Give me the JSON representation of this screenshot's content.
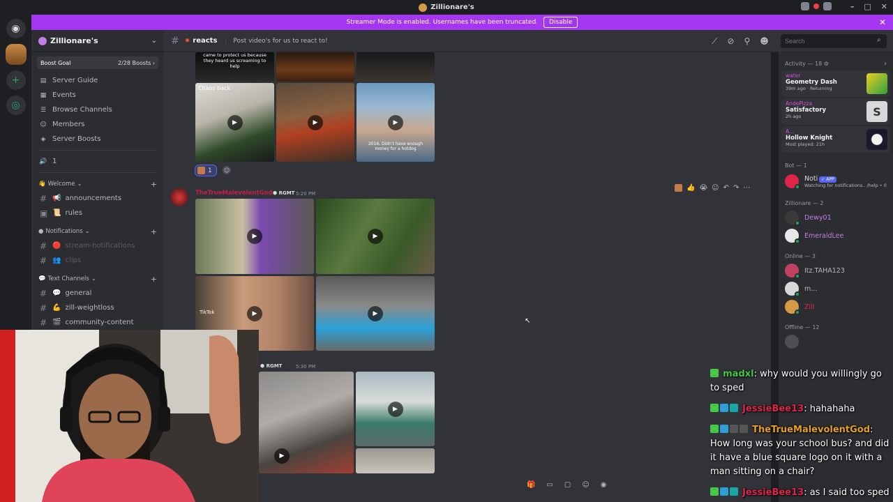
{
  "window": {
    "title": "Zillionare's"
  },
  "banner": {
    "message": "Streamer Mode is enabled. Usernames have been truncated.",
    "disable_label": "Disable",
    "color": "#a435f0"
  },
  "server": {
    "name": "Zillionare's",
    "boost_goal": "Boost Goal",
    "boost_count": "2/28 Boosts",
    "nav": [
      {
        "label": "Server Guide",
        "icon": "guide-icon"
      },
      {
        "label": "Events",
        "icon": "calendar-icon"
      },
      {
        "label": "Browse Channels",
        "icon": "browse-icon"
      },
      {
        "label": "Members",
        "icon": "members-icon"
      },
      {
        "label": "Server Boosts",
        "icon": "boost-icon"
      }
    ],
    "voice_count": "1",
    "categories": [
      {
        "name": "Welcome",
        "channels": [
          {
            "name": "announcements",
            "emoji": "📢"
          },
          {
            "name": "rules",
            "emoji": "📜"
          }
        ]
      },
      {
        "name": "Notifications",
        "channels": [
          {
            "name": "stream-notifications",
            "emoji": "🔴"
          },
          {
            "name": "clips",
            "emoji": "👥"
          }
        ]
      },
      {
        "name": "Text Channels",
        "channels": [
          {
            "name": "general",
            "emoji": "💬"
          },
          {
            "name": "zill-weightloss",
            "emoji": "💪"
          },
          {
            "name": "community-content",
            "emoji": "🎬"
          }
        ]
      }
    ]
  },
  "channel": {
    "name": "reacts",
    "topic": "Post video's for us to react to!",
    "search_placeholder": "Search"
  },
  "messages": {
    "reaction_count": "1",
    "author": "TheTrueMalevolentGod",
    "tag": "RGMT",
    "time1": "5:20 PM",
    "time2": "5:30 PM",
    "thumb_texts": {
      "t1": "came to protect us because they heard us screaming to help",
      "t2": "Chaos back",
      "t3": "2016, Didn't have enough money for a hotdog",
      "tiktok": "TikTok"
    }
  },
  "members": {
    "activity_header": "Activity — 18",
    "activities": [
      {
        "user": "water",
        "game": "Geometry Dash",
        "sub": "39m ago · Returning"
      },
      {
        "user": "AndePizza",
        "game": "Satisfactory",
        "sub": "2h ago"
      },
      {
        "user": "A...",
        "game": "Hollow Knight",
        "sub": "Most played: 21h"
      }
    ],
    "bot_header": "Bot — 1",
    "bot": {
      "name": "Noti",
      "badge": "APP",
      "sub": "Watching for notifications.. /help • 0"
    },
    "zill_header": "Zillionare — 2",
    "zill": [
      {
        "name": "Dewy01",
        "color": "#c27ee6"
      },
      {
        "name": "EmeraldLee",
        "color": "#c27ee6"
      }
    ],
    "online_header": "Online — 3",
    "online": [
      {
        "name": "Itz.TAHA123",
        "color": "#b5bac1"
      },
      {
        "name": "m...",
        "color": "#b5bac1"
      },
      {
        "name": "Zill",
        "color": "#e0244a"
      }
    ],
    "offline_header": "Offline — 12"
  },
  "chat": [
    {
      "user": "madxl",
      "user_color": "#46c849",
      "text": "why would you willingly go to sped"
    },
    {
      "user": "JessieBee13",
      "user_color": "#e0244a",
      "text": "hahahaha"
    },
    {
      "user": "TheTrueMalevolentGod",
      "user_color": "#e8a022",
      "text": "How long was your school bus? and did it have a blue square logo on it with a man sitting on a chair?"
    },
    {
      "user": "JessieBee13",
      "user_color": "#e0244a",
      "text": "as I said too sped"
    }
  ]
}
